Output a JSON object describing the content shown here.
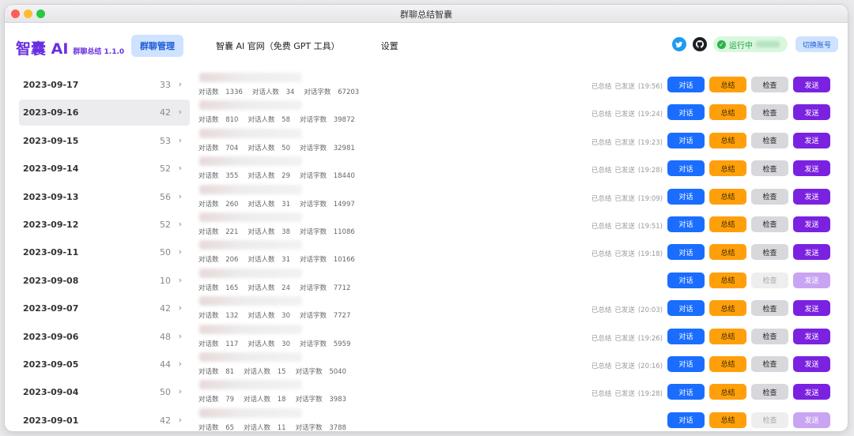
{
  "window": {
    "title": "群聊总结智囊"
  },
  "brand": {
    "name": "智囊 AI",
    "subtitle": "群聊总结 1.1.0"
  },
  "nav": [
    {
      "label": "群聊管理",
      "active": true
    },
    {
      "label": "智囊 AI 官网（免费 GPT 工具）",
      "active": false
    },
    {
      "label": "设置",
      "active": false
    }
  ],
  "header": {
    "status": "运行中",
    "switch_label": "切换账号"
  },
  "labels": {
    "msgs": "对话数",
    "people": "对话人数",
    "chars": "对话字数",
    "summarized": "已总结",
    "sent": "已发送",
    "chat": "对话",
    "summary": "总结",
    "check": "检查",
    "send": "发送"
  },
  "rows": [
    {
      "date": "2023-09-17",
      "count": "33",
      "msgs": "1336",
      "people": "34",
      "chars": "67203",
      "done": true,
      "time": "(19:56)"
    },
    {
      "date": "2023-09-16",
      "count": "42",
      "msgs": "810",
      "people": "58",
      "chars": "39872",
      "done": true,
      "time": "(19:24)",
      "selected": true
    },
    {
      "date": "2023-09-15",
      "count": "53",
      "msgs": "704",
      "people": "50",
      "chars": "32981",
      "done": true,
      "time": "(19:23)"
    },
    {
      "date": "2023-09-14",
      "count": "52",
      "msgs": "355",
      "people": "29",
      "chars": "18440",
      "done": true,
      "time": "(19:28)"
    },
    {
      "date": "2023-09-13",
      "count": "56",
      "msgs": "260",
      "people": "31",
      "chars": "14997",
      "done": true,
      "time": "(19:09)"
    },
    {
      "date": "2023-09-12",
      "count": "52",
      "msgs": "221",
      "people": "38",
      "chars": "11086",
      "done": true,
      "time": "(19:51)"
    },
    {
      "date": "2023-09-11",
      "count": "50",
      "msgs": "206",
      "people": "31",
      "chars": "10166",
      "done": true,
      "time": "(19:18)"
    },
    {
      "date": "2023-09-08",
      "count": "10",
      "msgs": "165",
      "people": "24",
      "chars": "7712",
      "done": false,
      "time": ""
    },
    {
      "date": "2023-09-07",
      "count": "42",
      "msgs": "132",
      "people": "30",
      "chars": "7727",
      "done": true,
      "time": "(20:03)"
    },
    {
      "date": "2023-09-06",
      "count": "48",
      "msgs": "117",
      "people": "30",
      "chars": "5959",
      "done": true,
      "time": "(19:26)"
    },
    {
      "date": "2023-09-05",
      "count": "44",
      "msgs": "81",
      "people": "15",
      "chars": "5040",
      "done": true,
      "time": "(20:16)"
    },
    {
      "date": "2023-09-04",
      "count": "50",
      "msgs": "79",
      "people": "18",
      "chars": "3983",
      "done": true,
      "time": "(19:28)"
    },
    {
      "date": "2023-09-01",
      "count": "42",
      "msgs": "65",
      "people": "11",
      "chars": "3788",
      "done": false,
      "time": ""
    }
  ]
}
